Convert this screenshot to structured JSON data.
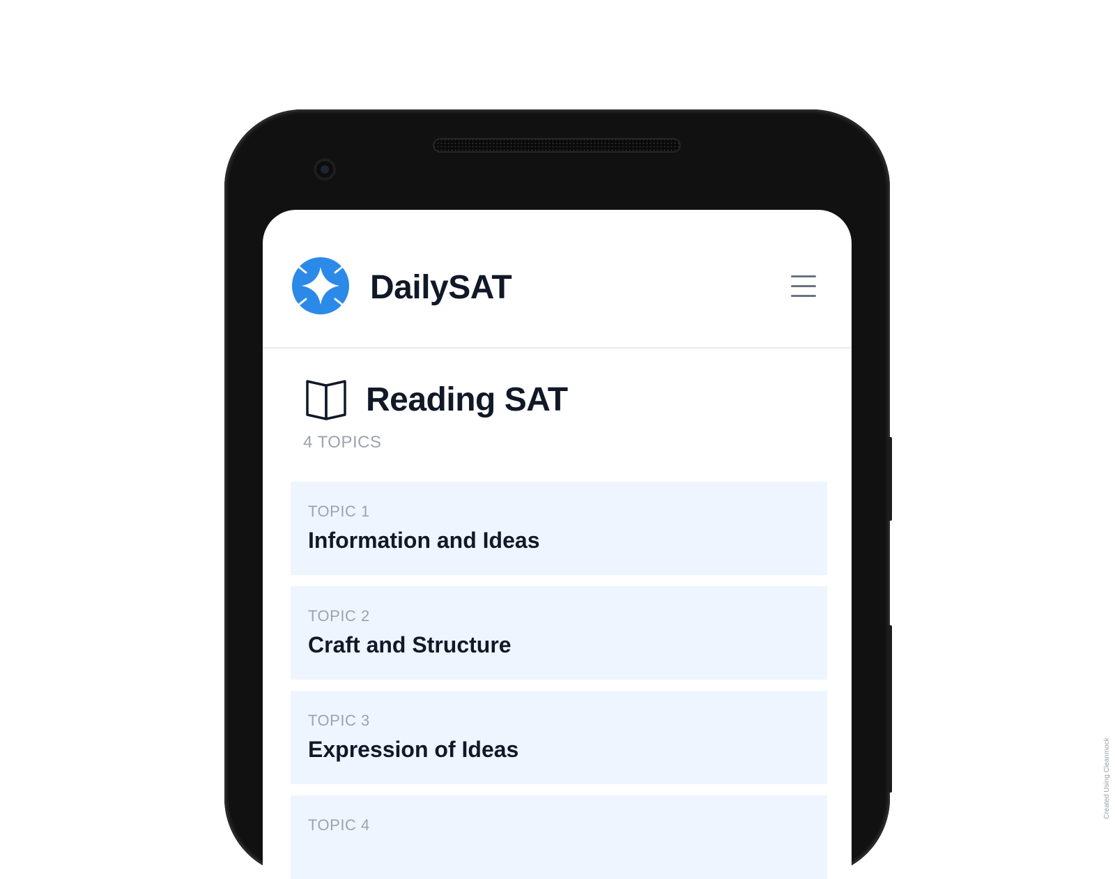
{
  "header": {
    "app_name": "DailySAT",
    "logo_icon": "diamond-star-logo-icon",
    "menu_icon": "hamburger-menu-icon"
  },
  "section": {
    "icon": "open-book-icon",
    "title": "Reading SAT",
    "topic_count": "4 TOPICS"
  },
  "topics": [
    {
      "label": "TOPIC 1",
      "name": "Information and Ideas"
    },
    {
      "label": "TOPIC 2",
      "name": "Craft and Structure"
    },
    {
      "label": "TOPIC 3",
      "name": "Expression of Ideas"
    },
    {
      "label": "TOPIC 4",
      "name": ""
    }
  ],
  "watermark": "Created Using Cleanmock",
  "colors": {
    "brand": "#2b8ae8",
    "card_background": "#eef5ff",
    "muted_text": "#9ca3af",
    "primary_text": "#111827"
  }
}
